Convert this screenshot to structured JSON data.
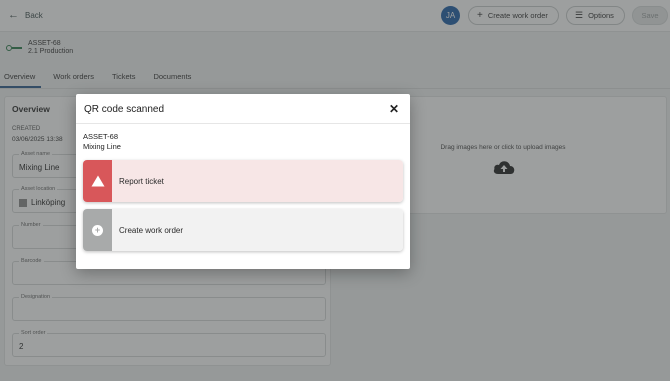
{
  "header": {
    "back_label": "Back",
    "avatar_initials": "JA",
    "create_work_order_label": "Create work order",
    "options_label": "Options",
    "save_label": "Save"
  },
  "asset": {
    "id": "ASSET-68",
    "subtitle": "2.1 Production"
  },
  "tabs": [
    {
      "label": "Overview",
      "active": true
    },
    {
      "label": "Work orders"
    },
    {
      "label": "Tickets"
    },
    {
      "label": "Documents"
    }
  ],
  "overview": {
    "title": "Overview",
    "created_label": "CREATED",
    "created_value": "03/06/2025  13:38",
    "fields": [
      {
        "label": "Asset name",
        "value": "Mixing Line"
      },
      {
        "label": "Asset location",
        "value": "Linköping"
      },
      {
        "label": "Number",
        "value": ""
      },
      {
        "label": "Barcode",
        "value": ""
      },
      {
        "label": "Designation",
        "value": ""
      },
      {
        "label": "Sort order",
        "value": "2"
      }
    ]
  },
  "images": {
    "drop_text": "Drag images here or click to upload images"
  },
  "modal": {
    "title": "QR code scanned",
    "asset_id": "ASSET-68",
    "asset_name": "Mixing Line",
    "report_label": "Report ticket",
    "create_label": "Create work order"
  },
  "colors": {
    "accent": "#1f5fa6",
    "danger": "#d8575a",
    "danger_bg": "#f7e6e6",
    "neutral": "#a8aaaa"
  }
}
